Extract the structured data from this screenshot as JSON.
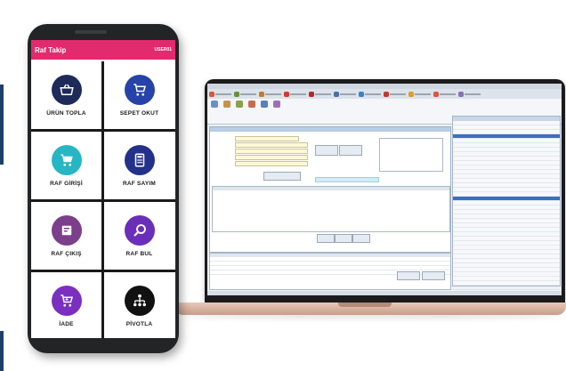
{
  "phone_app": {
    "title": "Raf Takip",
    "user": "USER01",
    "header_color": "#e22a6e",
    "menu": [
      {
        "label": "ÜRÜN TOPLA",
        "icon": "basket-icon",
        "color": "#1d2a5a"
      },
      {
        "label": "SEPET OKUT",
        "icon": "cart-icon",
        "color": "#2742a8"
      },
      {
        "label": "RAF GİRİŞİ",
        "icon": "cart-in-icon",
        "color": "#27b6c4"
      },
      {
        "label": "RAF SAYIM",
        "icon": "calculator-icon",
        "color": "#23318a"
      },
      {
        "label": "RAF ÇIKIŞ",
        "icon": "box-out-icon",
        "color": "#7c3f8c"
      },
      {
        "label": "RAF BUL",
        "icon": "search-icon",
        "color": "#6a2fb9"
      },
      {
        "label": "İADE",
        "icon": "return-cart-icon",
        "color": "#7a2fc1"
      },
      {
        "label": "PİVOTLA",
        "icon": "hierarchy-icon",
        "color": "#111111"
      }
    ]
  },
  "desktop_app": {
    "tabs": [
      {
        "color": "#d9563b"
      },
      {
        "color": "#6b8e3a"
      },
      {
        "color": "#c47a2a"
      },
      {
        "color": "#d6392c"
      },
      {
        "color": "#b02a2a"
      },
      {
        "color": "#4c6fa8"
      },
      {
        "color": "#3b82c4"
      },
      {
        "color": "#c2372b"
      },
      {
        "color": "#e29c2a"
      },
      {
        "color": "#d9563b"
      },
      {
        "color": "#8a6fb5"
      }
    ],
    "accent": "#3b6fc1"
  }
}
